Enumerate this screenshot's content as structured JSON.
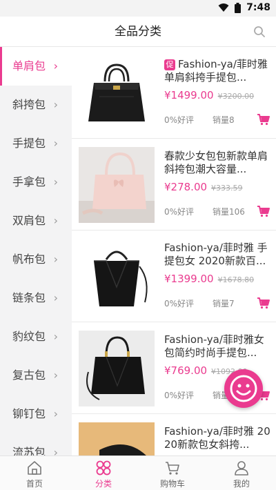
{
  "status": {
    "time": "7:48"
  },
  "header": {
    "title": "全品分类"
  },
  "categories": [
    {
      "label": "单肩包",
      "active": true
    },
    {
      "label": "斜挎包"
    },
    {
      "label": "手提包"
    },
    {
      "label": "手拿包"
    },
    {
      "label": "双肩包"
    },
    {
      "label": "帆布包"
    },
    {
      "label": "链条包"
    },
    {
      "label": "豹纹包"
    },
    {
      "label": "复古包"
    },
    {
      "label": "铆钉包"
    },
    {
      "label": "流苏包"
    }
  ],
  "products": [
    {
      "badge": "促",
      "name": "Fashion-ya/菲时雅单肩斜挎手提包...",
      "price": "¥1499.00",
      "original_price": "¥3200.00",
      "rating": "0%好评",
      "sales": "销量8"
    },
    {
      "name": "春款少女包包新款单肩斜挎包潮大容量...",
      "price": "¥278.00",
      "original_price": "¥333.59",
      "rating": "0%好评",
      "sales": "销量106"
    },
    {
      "name": "Fashion-ya/菲时雅 手提包女 2020新款百...",
      "price": "¥1399.00",
      "original_price": "¥1678.80",
      "rating": "0%好评",
      "sales": "销量7"
    },
    {
      "name": "Fashion-ya/菲时雅女包简约时尚手提包...",
      "price": "¥769.00",
      "original_price": "¥1092.00",
      "rating": "0%好评",
      "sales": "销量"
    },
    {
      "name": "Fashion-ya/菲时雅 2020新款包女斜挎...",
      "price": "",
      "original_price": "",
      "rating": "",
      "sales": ""
    }
  ],
  "tabbar": [
    {
      "label": "首页",
      "icon": "home-icon"
    },
    {
      "label": "分类",
      "icon": "category-icon",
      "active": true
    },
    {
      "label": "购物车",
      "icon": "cart-icon"
    },
    {
      "label": "我的",
      "icon": "user-icon"
    }
  ],
  "colors": {
    "accent": "#ea3b8f",
    "sidebar_bg": "#f3f3f4"
  }
}
